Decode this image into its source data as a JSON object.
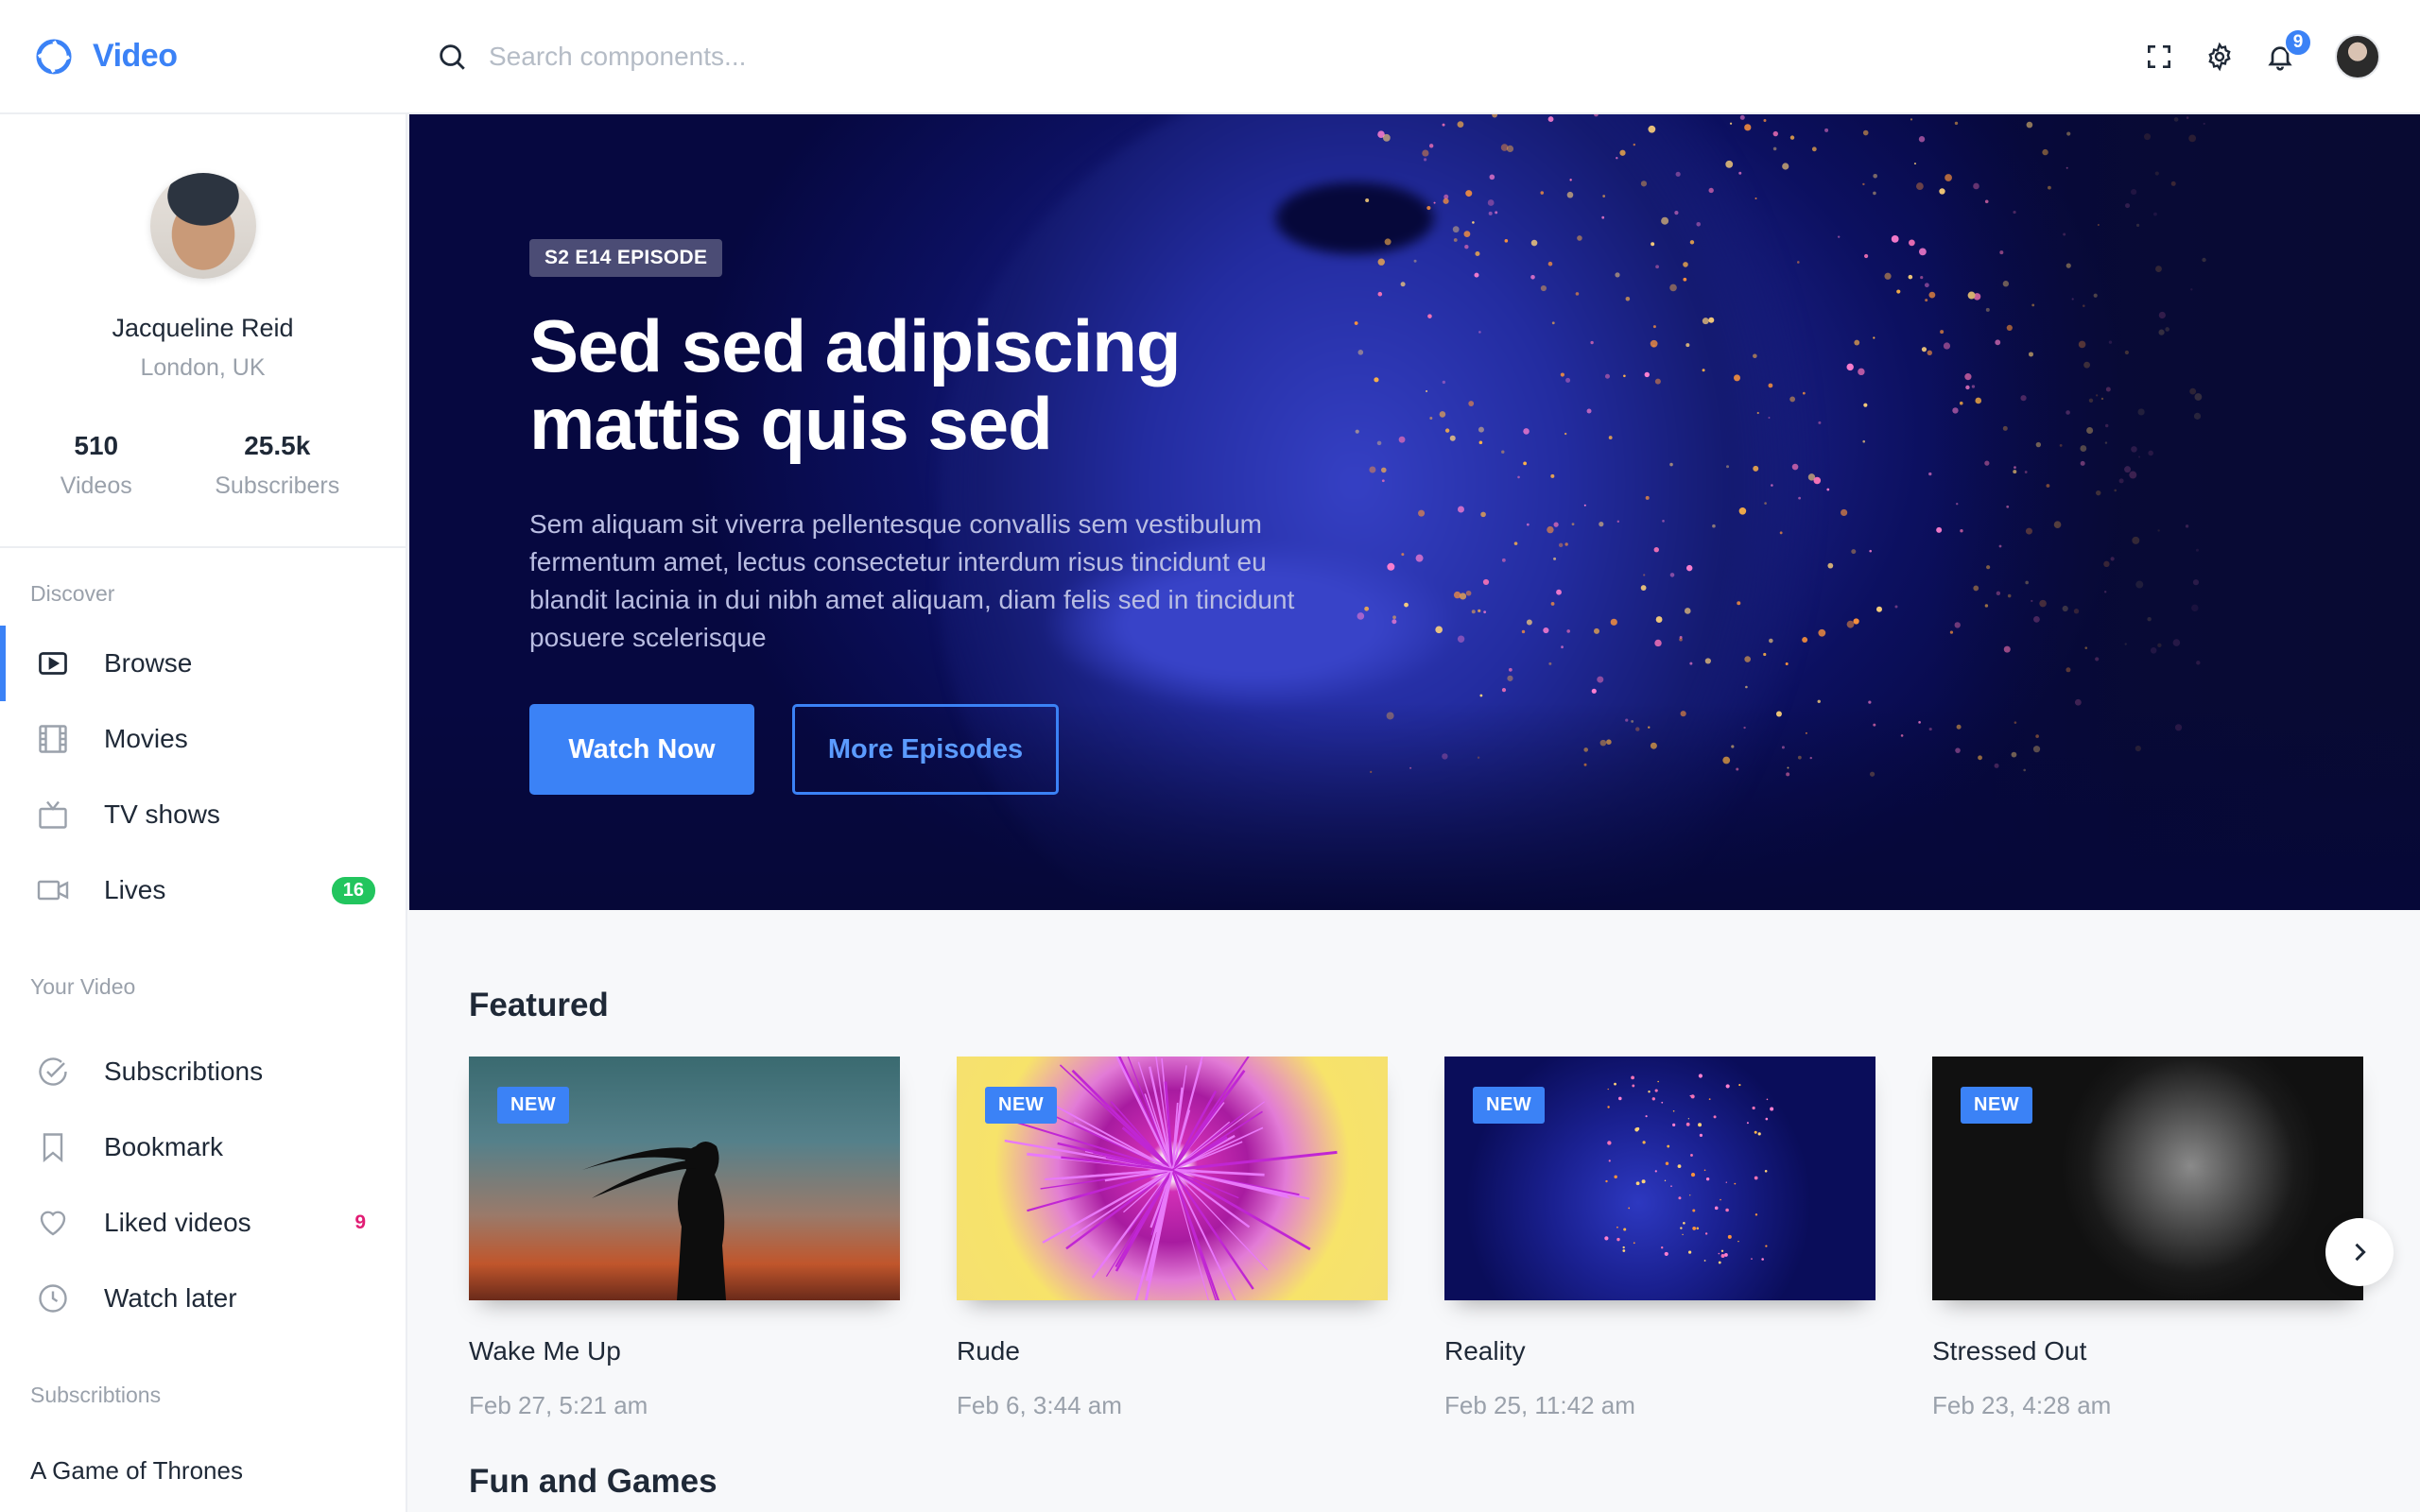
{
  "app": {
    "brand": "Video"
  },
  "search": {
    "placeholder": "Search components..."
  },
  "header": {
    "notification_count": "9"
  },
  "profile": {
    "name": "Jacqueline Reid",
    "location": "London, UK",
    "stats": [
      {
        "value": "510",
        "label": "Videos"
      },
      {
        "value": "25.5k",
        "label": "Subscribers"
      }
    ]
  },
  "sidebar": {
    "discover_title": "Discover",
    "discover": [
      {
        "label": "Browse",
        "icon": "play-icon",
        "active": true
      },
      {
        "label": "Movies",
        "icon": "film-icon"
      },
      {
        "label": "TV shows",
        "icon": "tv-icon"
      },
      {
        "label": "Lives",
        "icon": "camera-icon",
        "badge": "16"
      }
    ],
    "your_video_title": "Your Video",
    "your_video": [
      {
        "label": "Subscribtions",
        "icon": "check-circle-icon"
      },
      {
        "label": "Bookmark",
        "icon": "bookmark-icon"
      },
      {
        "label": "Liked videos",
        "icon": "heart-icon",
        "count": "9"
      },
      {
        "label": "Watch later",
        "icon": "clock-icon"
      }
    ],
    "subscriptions_title": "Subscribtions",
    "subscriptions": [
      "A Game of Thrones"
    ]
  },
  "hero": {
    "tag": "S2 E14 EPISODE",
    "title_line1": "Sed sed adipiscing",
    "title_line2": "mattis quis sed",
    "description": "Sem aliquam sit viverra pellentesque convallis sem vestibulum fermentum amet, lectus consectetur interdum risus tincidunt eu blandit lacinia in dui nibh amet aliquam, diam felis sed in tincidunt posuere scelerisque",
    "primary_button": "Watch Now",
    "secondary_button": "More Episodes"
  },
  "featured": {
    "title": "Featured",
    "badge": "NEW",
    "items": [
      {
        "title": "Wake Me Up",
        "date": "Feb 27, 5:21 am"
      },
      {
        "title": "Rude",
        "date": "Feb 6, 3:44 am"
      },
      {
        "title": "Reality",
        "date": "Feb 25, 11:42 am"
      },
      {
        "title": "Stressed Out",
        "date": "Feb 23, 4:28 am"
      }
    ]
  },
  "fun_and_games": {
    "title": "Fun and Games"
  },
  "colors": {
    "accent": "#3b82f6",
    "live_badge": "#22c55e",
    "liked_count": "#e11d74"
  }
}
